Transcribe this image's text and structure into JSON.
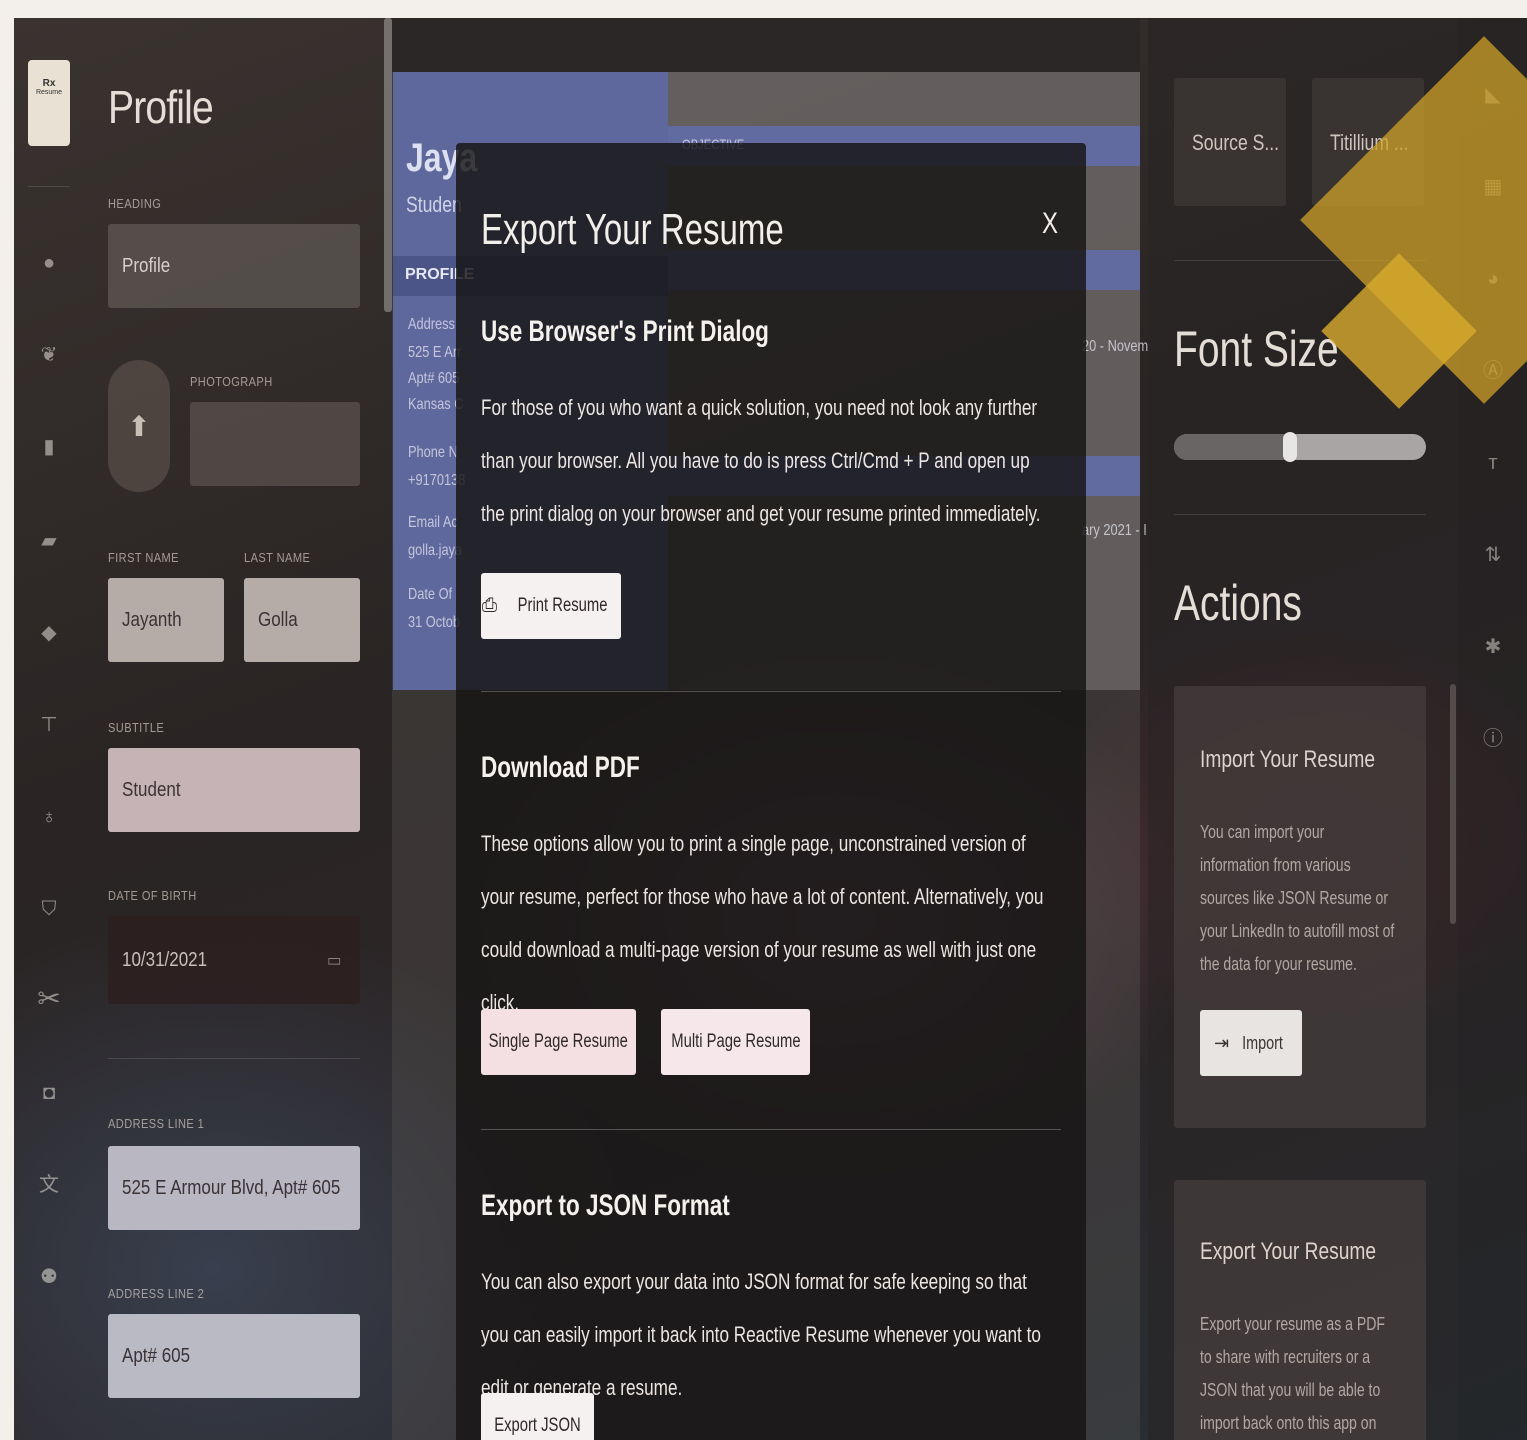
{
  "sidebar": {
    "logo_main": "Rx",
    "logo_sub": "Resume",
    "icons": [
      "user-icon",
      "twitter-icon",
      "document-icon",
      "briefcase-icon",
      "layers-icon",
      "project-icon",
      "award-icon",
      "shield-icon",
      "scissors-icon",
      "gamepad-icon",
      "translate-icon",
      "people-icon"
    ]
  },
  "editor": {
    "title": "Profile",
    "heading_label": "HEADING",
    "heading_value": "Profile",
    "photograph_label": "PHOTOGRAPH",
    "first_name_label": "FIRST NAME",
    "first_name_value": "Jayanth",
    "last_name_label": "LAST NAME",
    "last_name_value": "Golla",
    "subtitle_label": "SUBTITLE",
    "subtitle_value": "Student",
    "dob_label": "DATE OF BIRTH",
    "dob_value": "10/31/2021",
    "address1_label": "ADDRESS LINE 1",
    "address1_value": "525 E Armour Blvd, Apt# 605",
    "address2_label": "ADDRESS LINE 2",
    "address2_value": "Apt# 605"
  },
  "preview": {
    "name": "Jaya",
    "subtitle": "Studen",
    "objective_heading": "OBJECTIVE",
    "profile_heading": "PROFILE",
    "address_label": "Address",
    "address_line1": "525 E Arr",
    "address_line2": "Apt# 605",
    "address_line3": "Kansas C",
    "phone_label": "Phone N",
    "phone_value": "+9170138",
    "email_label": "Email Ac",
    "email_value": "golla.jaya",
    "dob_label": "Date Of",
    "dob_value": "31 Octob",
    "date_range_1": "20 - Novem",
    "date_range_2": "ary 2021 - I"
  },
  "right_panel": {
    "font_options": [
      "Source S...",
      "Titillium ..."
    ],
    "font_size_title": "Font Size",
    "font_size_level": 0.46,
    "actions_title": "Actions",
    "import_card": {
      "title": "Import Your Resume",
      "text": "You can import your information from various sources like JSON Resume or your LinkedIn to autofill most of the data for your resume.",
      "button": "Import"
    },
    "export_card": {
      "title": "Export Your Resume",
      "text": "Export your resume as a PDF to share with recruiters or a JSON that you will be able to import back onto this app on another computer."
    }
  },
  "right_rail": {
    "icons": [
      "tag-icon",
      "layout-icon",
      "palette-icon",
      "font-icon",
      "text-size-icon",
      "sort-icon",
      "settings-icon",
      "info-icon"
    ]
  },
  "modal": {
    "title": "Export Your Resume",
    "close": "X",
    "print": {
      "title": "Use Browser's Print Dialog",
      "text": "For those of you who want a quick solution, you need not look any further than your browser. All you have to do is press Ctrl/Cmd + P and open up the print dialog on your browser and get your resume printed immediately.",
      "button": "Print Resume"
    },
    "pdf": {
      "title": "Download PDF",
      "text": "These options allow you to print a single page, unconstrained version of your resume, perfect for those who have a lot of content. Alternatively, you could download a multi-page version of your resume as well with just one click.",
      "single_button": "Single Page Resume",
      "multi_button": "Multi Page Resume"
    },
    "json": {
      "title": "Export to JSON Format",
      "text": "You can also export your data into JSON format for safe keeping so that you can easily import it back into Reactive Resume whenever you want to edit or generate a resume.",
      "button": "Export JSON"
    }
  },
  "colors": {
    "resume_accent": "#626ca5",
    "highlight_gold": "#cda028",
    "modal_bg": "#161414"
  }
}
